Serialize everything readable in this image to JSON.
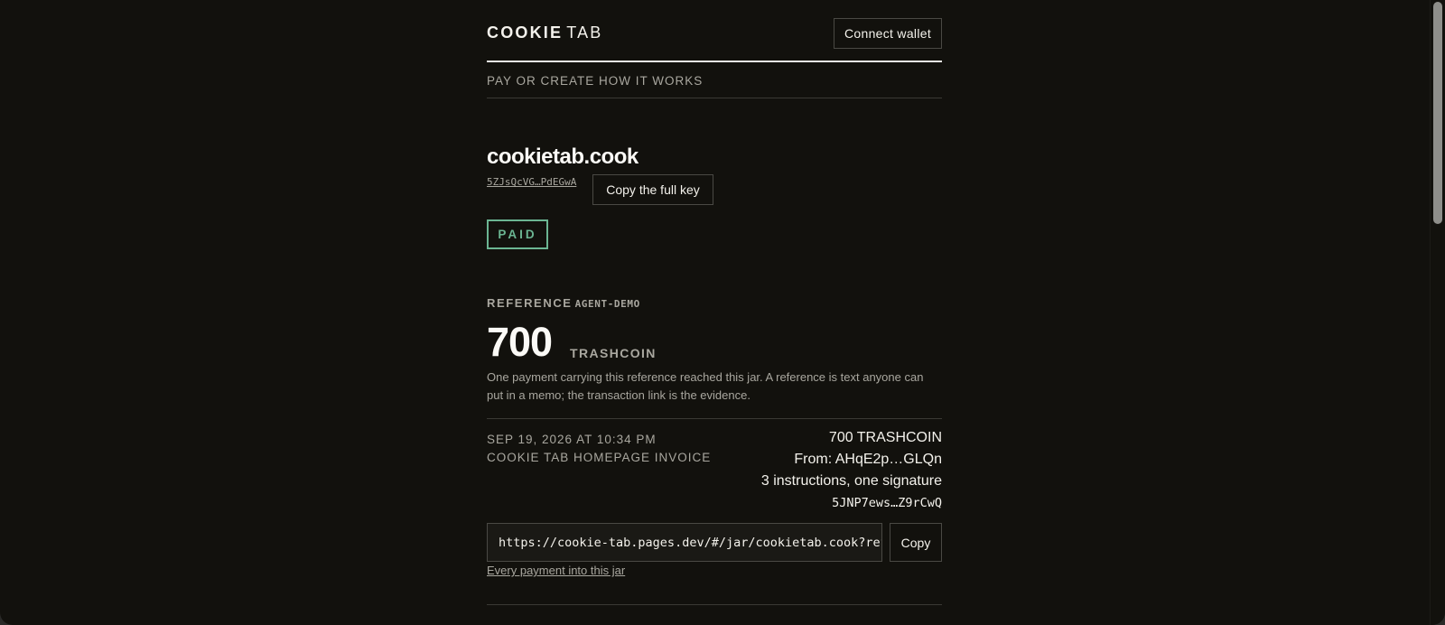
{
  "header": {
    "brand_bold": "COOKIE",
    "brand_light": "TAB",
    "connect_label": "Connect wallet"
  },
  "nav": {
    "items": [
      {
        "label": "PAY OR CREATE"
      },
      {
        "label": "HOW IT WORKS"
      }
    ]
  },
  "jar": {
    "title": "cookietab.cook",
    "key_short": "5ZJsQcVG…PdEGwA",
    "copy_key_label": "Copy the full key",
    "status": "PAID"
  },
  "reference": {
    "label": "REFERENCE",
    "value": "AGENT-DEMO",
    "amount": "700",
    "unit": "TRASHCOIN",
    "description": "One payment carrying this reference reached this jar. A reference is text anyone can put in a memo; the transaction link is the evidence."
  },
  "transaction": {
    "date": "SEP 19, 2026 AT 10:34 PM",
    "memo": "COOKIE TAB HOMEPAGE INVOICE",
    "amount": "700 TRASHCOIN",
    "from": "From: AHqE2p…GLQn",
    "instructions": "3 instructions, one signature",
    "signature": "5JNP7ews…Z9rCwQ"
  },
  "share": {
    "url": "https://cookie-tab.pages.dev/#/jar/cookietab.cook?reference=agent-demo",
    "copy_label": "Copy",
    "all_payments_label": "Every payment into this jar"
  },
  "colors": {
    "background": "#12110d",
    "text": "#f1efe8",
    "muted": "#a9a79f",
    "paid": "#6bb592"
  }
}
